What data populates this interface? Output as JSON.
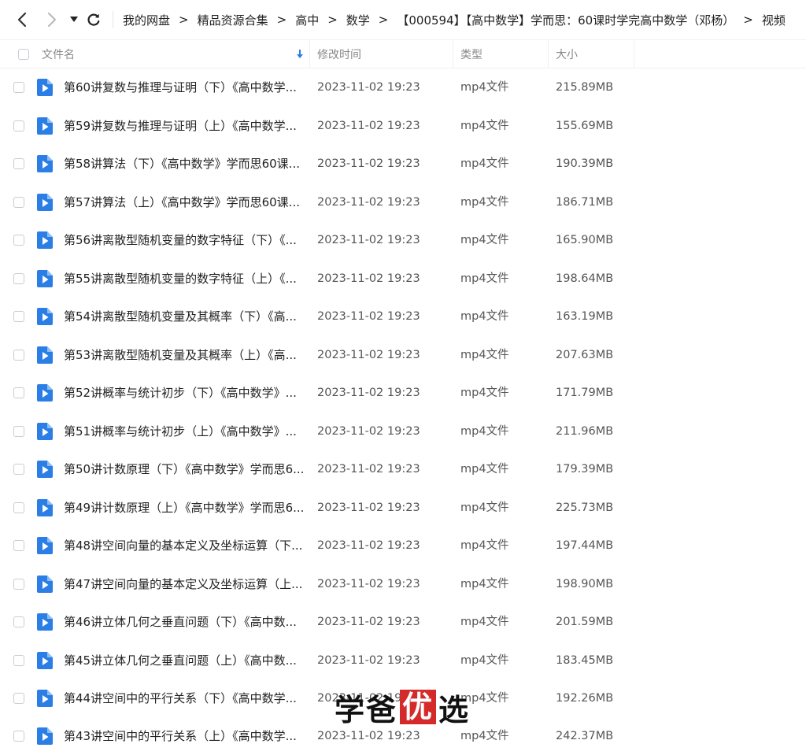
{
  "toolbar": {
    "back_icon": "chevron-left-icon",
    "forward_icon": "chevron-right-icon",
    "dropdown_icon": "caret-down-icon",
    "refresh_icon": "refresh-icon",
    "breadcrumb": [
      "我的网盘",
      "精品资源合集",
      "高中",
      "数学",
      "【000594】【高中数学】学而思：60课时学完高中数学（邓杨）",
      "视频"
    ],
    "separator": ">"
  },
  "table": {
    "headers": {
      "name": "文件名",
      "modified": "修改时间",
      "type": "类型",
      "size": "大小"
    },
    "sort_icon": "arrow-down-icon",
    "accent_color": "#2b7ee6",
    "rows": [
      {
        "name": "第60讲复数与推理与证明（下）《高中数学...",
        "modified": "2023-11-02 19:23",
        "type": "mp4文件",
        "size": "215.89MB"
      },
      {
        "name": "第59讲复数与推理与证明（上）《高中数学...",
        "modified": "2023-11-02 19:23",
        "type": "mp4文件",
        "size": "155.69MB"
      },
      {
        "name": "第58讲算法（下）《高中数学》学而思60课...",
        "modified": "2023-11-02 19:23",
        "type": "mp4文件",
        "size": "190.39MB"
      },
      {
        "name": "第57讲算法（上）《高中数学》学而思60课...",
        "modified": "2023-11-02 19:23",
        "type": "mp4文件",
        "size": "186.71MB"
      },
      {
        "name": "第56讲离散型随机变量的数字特征（下）《...",
        "modified": "2023-11-02 19:23",
        "type": "mp4文件",
        "size": "165.90MB"
      },
      {
        "name": "第55讲离散型随机变量的数字特征（上）《...",
        "modified": "2023-11-02 19:23",
        "type": "mp4文件",
        "size": "198.64MB"
      },
      {
        "name": "第54讲离散型随机变量及其概率（下）《高...",
        "modified": "2023-11-02 19:23",
        "type": "mp4文件",
        "size": "163.19MB"
      },
      {
        "name": "第53讲离散型随机变量及其概率（上）《高...",
        "modified": "2023-11-02 19:23",
        "type": "mp4文件",
        "size": "207.63MB"
      },
      {
        "name": "第52讲概率与统计初步（下）《高中数学》...",
        "modified": "2023-11-02 19:23",
        "type": "mp4文件",
        "size": "171.79MB"
      },
      {
        "name": "第51讲概率与统计初步（上）《高中数学》...",
        "modified": "2023-11-02 19:23",
        "type": "mp4文件",
        "size": "211.96MB"
      },
      {
        "name": "第50讲计数原理（下）《高中数学》学而思6...",
        "modified": "2023-11-02 19:23",
        "type": "mp4文件",
        "size": "179.39MB"
      },
      {
        "name": "第49讲计数原理（上）《高中数学》学而思6...",
        "modified": "2023-11-02 19:23",
        "type": "mp4文件",
        "size": "225.73MB"
      },
      {
        "name": "第48讲空间向量的基本定义及坐标运算（下...",
        "modified": "2023-11-02 19:23",
        "type": "mp4文件",
        "size": "197.44MB"
      },
      {
        "name": "第47讲空间向量的基本定义及坐标运算（上...",
        "modified": "2023-11-02 19:23",
        "type": "mp4文件",
        "size": "198.90MB"
      },
      {
        "name": "第46讲立体几何之垂直问题（下）《高中数...",
        "modified": "2023-11-02 19:23",
        "type": "mp4文件",
        "size": "201.59MB"
      },
      {
        "name": "第45讲立体几何之垂直问题（上）《高中数...",
        "modified": "2023-11-02 19:23",
        "type": "mp4文件",
        "size": "183.45MB"
      },
      {
        "name": "第44讲空间中的平行关系（下）《高中数学...",
        "modified": "2023-11-02 19:23",
        "type": "mp4文件",
        "size": "192.26MB"
      },
      {
        "name": "第43讲空间中的平行关系（上）《高中数学...",
        "modified": "2023-11-02 19:23",
        "type": "mp4文件",
        "size": "242.37MB"
      }
    ]
  },
  "watermark": {
    "text_before": "学爸",
    "text_highlight": "优",
    "text_after": "选",
    "highlight_color": "#d42a2a"
  }
}
